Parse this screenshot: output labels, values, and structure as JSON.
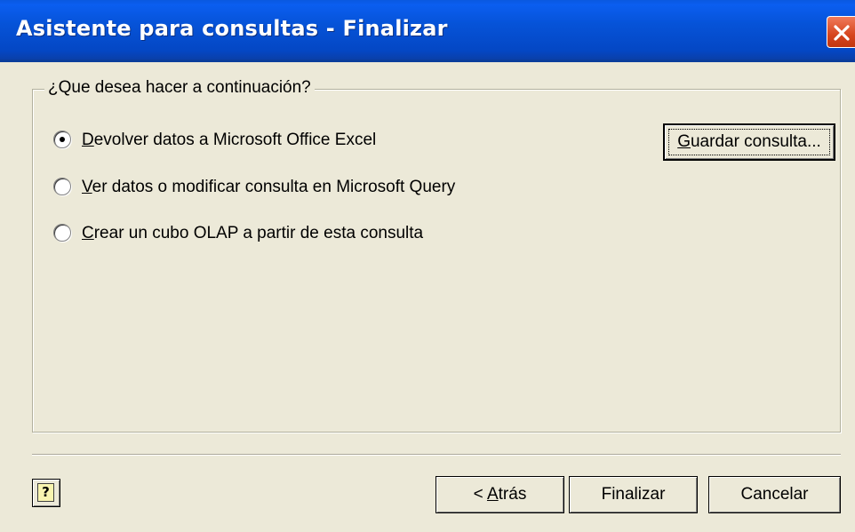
{
  "window": {
    "title": "Asistente para consultas - Finalizar"
  },
  "group": {
    "legend": "¿Que desea hacer a continuación?"
  },
  "options": [
    {
      "accesskey": "D",
      "rest": "evolver datos a Microsoft Office Excel",
      "selected": true
    },
    {
      "accesskey": "V",
      "rest": "er datos o modificar consulta en Microsoft Query",
      "selected": false
    },
    {
      "accesskey": "C",
      "rest": "rear un cubo OLAP a partir de esta consulta",
      "selected": false
    }
  ],
  "save_button": {
    "accesskey": "G",
    "rest": "uardar consulta..."
  },
  "footer": {
    "help_label": "?",
    "back": {
      "prefix": "< ",
      "accesskey": "A",
      "rest": "trás"
    },
    "finish_label": "Finalizar",
    "cancel_label": "Cancelar"
  },
  "colors": {
    "title_bar": "#0653d8",
    "window_bg": "#ece9d8",
    "close_button": "#d6451e"
  },
  "icons": [
    "close-icon",
    "help-icon",
    "radio-selected",
    "radio-unselected"
  ]
}
